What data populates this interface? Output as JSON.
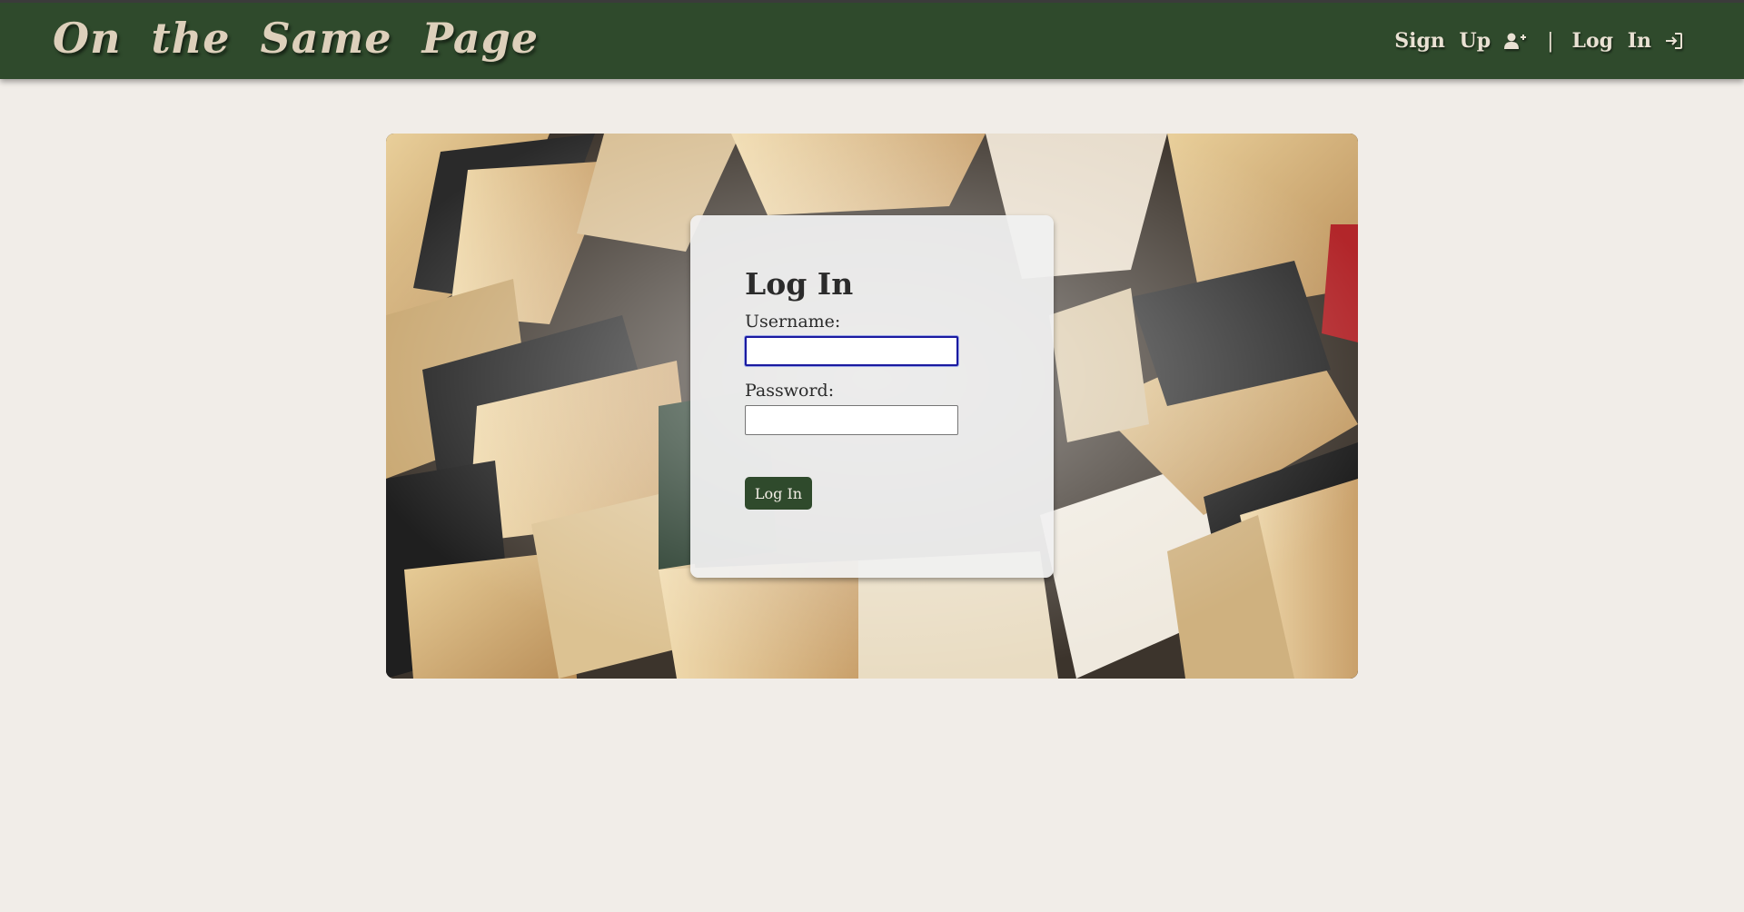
{
  "header": {
    "brand": "On the Same Page",
    "nav": {
      "signup_label": "Sign Up",
      "signup_icon": "user-plus-icon",
      "separator": "|",
      "login_label": "Log In",
      "login_icon": "sign-in-icon"
    }
  },
  "login_form": {
    "title": "Log In",
    "username_label": "Username:",
    "username_value": "",
    "password_label": "Password:",
    "password_value": "",
    "submit_label": "Log In"
  },
  "hero": {
    "image": "open-books-background"
  },
  "colors": {
    "header_bg": "#2f4a2c",
    "page_bg": "#f1ede8",
    "brand_text": "#ddd0bb",
    "button_bg": "#2f4a2c",
    "focus_border": "#1a1aa0"
  }
}
